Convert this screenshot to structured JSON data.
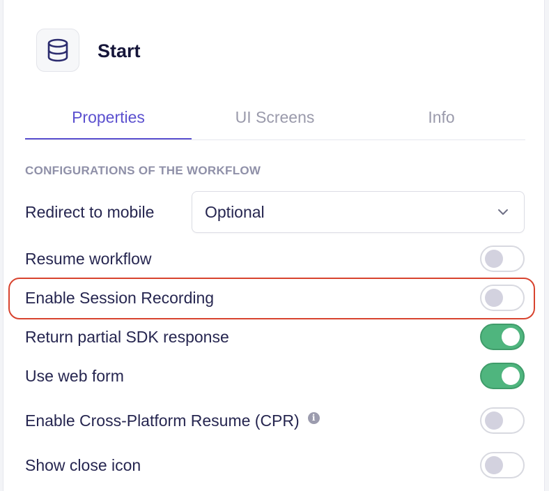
{
  "node": {
    "icon": "database-icon",
    "title": "Start"
  },
  "tabs": [
    {
      "label": "Properties",
      "active": true
    },
    {
      "label": "UI Screens",
      "active": false
    },
    {
      "label": "Info",
      "active": false
    }
  ],
  "section_heading": "CONFIGURATIONS OF THE WORKFLOW",
  "redirect": {
    "label": "Redirect to mobile",
    "value": "Optional",
    "icon": "chevron-down-icon"
  },
  "settings": [
    {
      "label": "Resume workflow",
      "enabled": false
    },
    {
      "label": "Enable Session Recording",
      "enabled": false,
      "highlighted": true
    },
    {
      "label": "Return partial SDK response",
      "enabled": true
    },
    {
      "label": "Use web form",
      "enabled": true
    },
    {
      "label": "Enable Cross-Platform Resume (CPR)",
      "enabled": false,
      "info_icon": "info-icon"
    },
    {
      "label": "Show close icon",
      "enabled": false
    }
  ],
  "colors": {
    "accent": "#5b50cf",
    "toggle_on": "#4fb57e",
    "highlight": "#d8432e",
    "text": "#262650"
  }
}
